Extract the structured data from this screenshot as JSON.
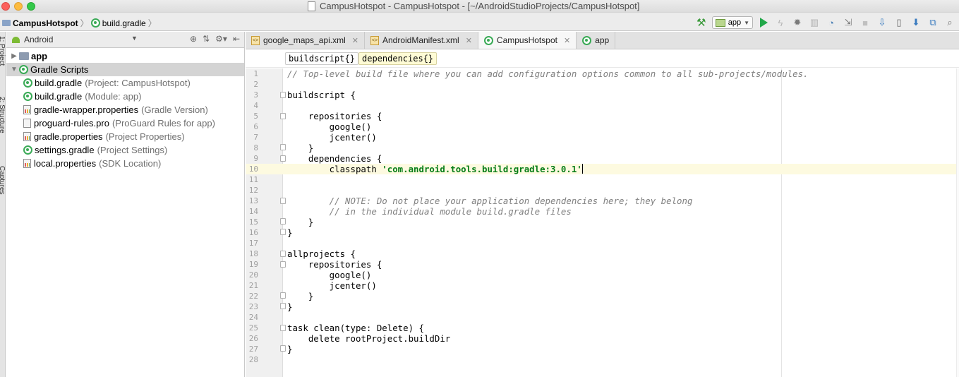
{
  "window": {
    "title": "CampusHotspot - CampusHotspot - [~/AndroidStudioProjects/CampusHotspot]"
  },
  "navbar": {
    "project_crumb": "CampusHotspot",
    "file_crumb": "build.gradle",
    "run_config": "app"
  },
  "sidestrip": {
    "labels": [
      "1: Project",
      "2: Structure",
      "Captures"
    ]
  },
  "project_panel": {
    "view_mode": "Android",
    "tree": [
      {
        "label": "app",
        "hint": "",
        "kind": "folder",
        "expanded": false,
        "indent": 0,
        "bold": true
      },
      {
        "label": "Gradle Scripts",
        "hint": "",
        "kind": "gradle",
        "expanded": true,
        "indent": 0,
        "selected": true
      },
      {
        "label": "build.gradle",
        "hint": "(Project: CampusHotspot)",
        "kind": "gradle",
        "indent": 1
      },
      {
        "label": "build.gradle",
        "hint": "(Module: app)",
        "kind": "gradle",
        "indent": 1
      },
      {
        "label": "gradle-wrapper.properties",
        "hint": "(Gradle Version)",
        "kind": "props",
        "indent": 1
      },
      {
        "label": "proguard-rules.pro",
        "hint": "(ProGuard Rules for app)",
        "kind": "file",
        "indent": 1
      },
      {
        "label": "gradle.properties",
        "hint": "(Project Properties)",
        "kind": "props",
        "indent": 1
      },
      {
        "label": "settings.gradle",
        "hint": "(Project Settings)",
        "kind": "gradle",
        "indent": 1
      },
      {
        "label": "local.properties",
        "hint": "(SDK Location)",
        "kind": "props",
        "indent": 1
      }
    ]
  },
  "editor": {
    "tabs": [
      {
        "label": "google_maps_api.xml",
        "icon": "xml",
        "closable": true,
        "active": false
      },
      {
        "label": "AndroidManifest.xml",
        "icon": "manifest",
        "closable": true,
        "active": false
      },
      {
        "label": "CampusHotspot",
        "icon": "gradle",
        "closable": true,
        "active": true
      },
      {
        "label": "app",
        "icon": "gradle",
        "closable": false,
        "active": false
      }
    ],
    "breadcrumbs": [
      "buildscript{}",
      "dependencies{}"
    ],
    "current_line": 10,
    "code_lines": [
      {
        "text": "// Top-level build file where you can add configuration options common to all sub-projects/modules.",
        "type": "comment"
      },
      {
        "text": ""
      },
      {
        "text": "buildscript {",
        "fold": "open"
      },
      {
        "text": ""
      },
      {
        "text": "    repositories {",
        "fold": "open"
      },
      {
        "text": "        google()"
      },
      {
        "text": "        jcenter()"
      },
      {
        "text": "    }",
        "fold": "close"
      },
      {
        "text": "    dependencies {",
        "fold": "open"
      },
      {
        "text": "        classpath ",
        "string": "'com.android.tools.build:gradle:3.0.1'",
        "caret": true
      },
      {
        "text": ""
      },
      {
        "text": ""
      },
      {
        "text": "        // NOTE: Do not place your application dependencies here; they belong",
        "type": "comment",
        "fold": "open"
      },
      {
        "text": "        // in the individual module build.gradle files",
        "type": "comment"
      },
      {
        "text": "    }",
        "fold": "close"
      },
      {
        "text": "}",
        "fold": "close"
      },
      {
        "text": ""
      },
      {
        "text": "allprojects {",
        "fold": "open"
      },
      {
        "text": "    repositories {",
        "fold": "open"
      },
      {
        "text": "        google()"
      },
      {
        "text": "        jcenter()"
      },
      {
        "text": "    }",
        "fold": "close"
      },
      {
        "text": "}",
        "fold": "close"
      },
      {
        "text": ""
      },
      {
        "text": "task clean(type: Delete) {",
        "fold": "open"
      },
      {
        "text": "    delete rootProject.buildDir"
      },
      {
        "text": "}",
        "fold": "close"
      },
      {
        "text": ""
      }
    ]
  },
  "icons": {
    "build": "hammer-icon",
    "run": "run-icon",
    "debug": "bug-icon",
    "apply": "lightning-icon",
    "coverage": "coverage-icon",
    "profile": "profiler-icon",
    "attach": "attach-debugger-icon",
    "stop": "stop-icon",
    "sync": "sync-gradle-icon",
    "avd": "avd-manager-icon",
    "sdk": "sdk-manager-icon",
    "structure": "project-structure-icon",
    "search": "search-icon"
  },
  "colors": {
    "accent_green": "#28a745",
    "current_line": "#fdfae0",
    "comment": "#808080",
    "string": "#067d17"
  }
}
